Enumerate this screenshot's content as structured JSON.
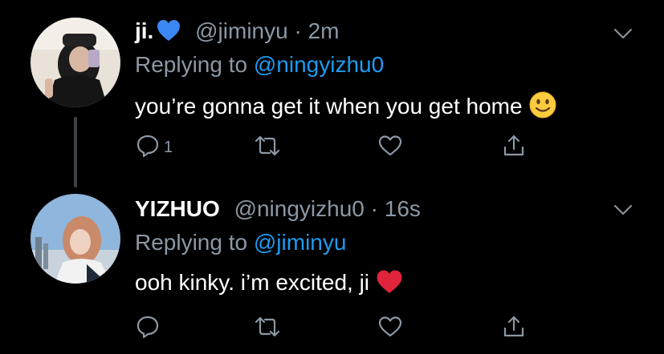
{
  "tweets": [
    {
      "name": "ji.",
      "name_emoji": "blue-heart",
      "handle": "@jiminyu",
      "separator": "·",
      "time": "2m",
      "replying_prefix": "Replying to ",
      "replying_to": "@ningyizhu0",
      "text": "you’re gonna get it when you get home",
      "text_emoji": "slightly-smiling-face",
      "reply_count": "1"
    },
    {
      "name": "YIZHUO",
      "handle": "@ningyizhu0",
      "separator": "·",
      "time": "16s",
      "replying_prefix": "Replying to ",
      "replying_to": "@jiminyu",
      "text": "ooh kinky. i’m excited, ji",
      "text_emoji": "red-heart",
      "reply_count": ""
    }
  ],
  "colors": {
    "background": "#000000",
    "secondary_text": "#8b98a5",
    "link": "#1d9bf0",
    "heart_blue": "#3b88f5",
    "heart_red": "#e0243b"
  }
}
